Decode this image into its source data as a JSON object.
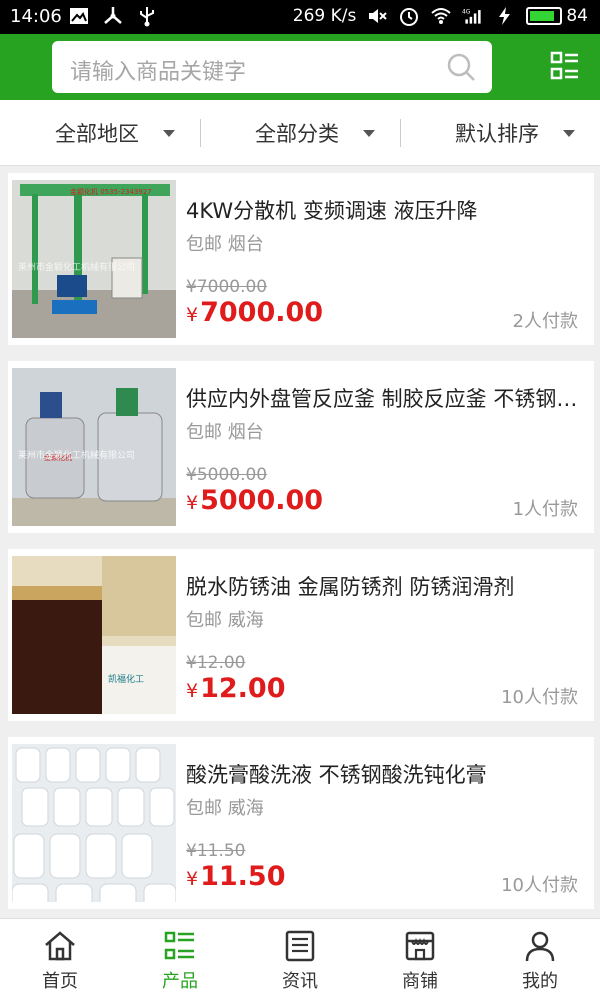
{
  "status": {
    "time": "14:06",
    "speed": "269 K/s",
    "battery": "84",
    "network": "4G"
  },
  "search": {
    "placeholder": "请输入商品关键字"
  },
  "filters": [
    {
      "label": "全部地区"
    },
    {
      "label": "全部分类"
    },
    {
      "label": "默认排序"
    }
  ],
  "products": [
    {
      "title": "4KW分散机 变频调速 液压升降",
      "shipping": "包邮",
      "city": "烟台",
      "old_price": "¥7000.00",
      "price": "7000.00",
      "sold": "2人付款",
      "watermark": "莱州市金颖化工机械有限公司",
      "brand_tag": "金颖化机 0535-2343927"
    },
    {
      "title": "供应内外盘管反应釜 制胶反应釜 不锈钢反应釜",
      "shipping": "包邮",
      "city": "烟台",
      "old_price": "¥5000.00",
      "price": "5000.00",
      "sold": "1人付款",
      "watermark": "莱州市金颖化工机械有限公司",
      "brand_tag": "金颖化机"
    },
    {
      "title": "脱水防锈油 金属防锈剂 防锈润滑剂",
      "shipping": "包邮",
      "city": "威海",
      "old_price": "¥12.00",
      "price": "12.00",
      "sold": "10人付款",
      "brand_tag": "凯福化工"
    },
    {
      "title": "酸洗膏酸洗液 不锈钢酸洗钝化膏",
      "shipping": "包邮",
      "city": "威海",
      "old_price": "¥11.50",
      "price": "11.50",
      "sold": "10人付款"
    }
  ],
  "currency_symbol": "¥",
  "nav": [
    {
      "label": "首页",
      "icon": "home-icon"
    },
    {
      "label": "产品",
      "icon": "list-icon",
      "active": true
    },
    {
      "label": "资讯",
      "icon": "news-icon"
    },
    {
      "label": "商铺",
      "icon": "store-icon"
    },
    {
      "label": "我的",
      "icon": "user-icon"
    }
  ],
  "colors": {
    "brand_green": "#27a321",
    "price_red": "#e01b1b",
    "muted": "#999999"
  }
}
